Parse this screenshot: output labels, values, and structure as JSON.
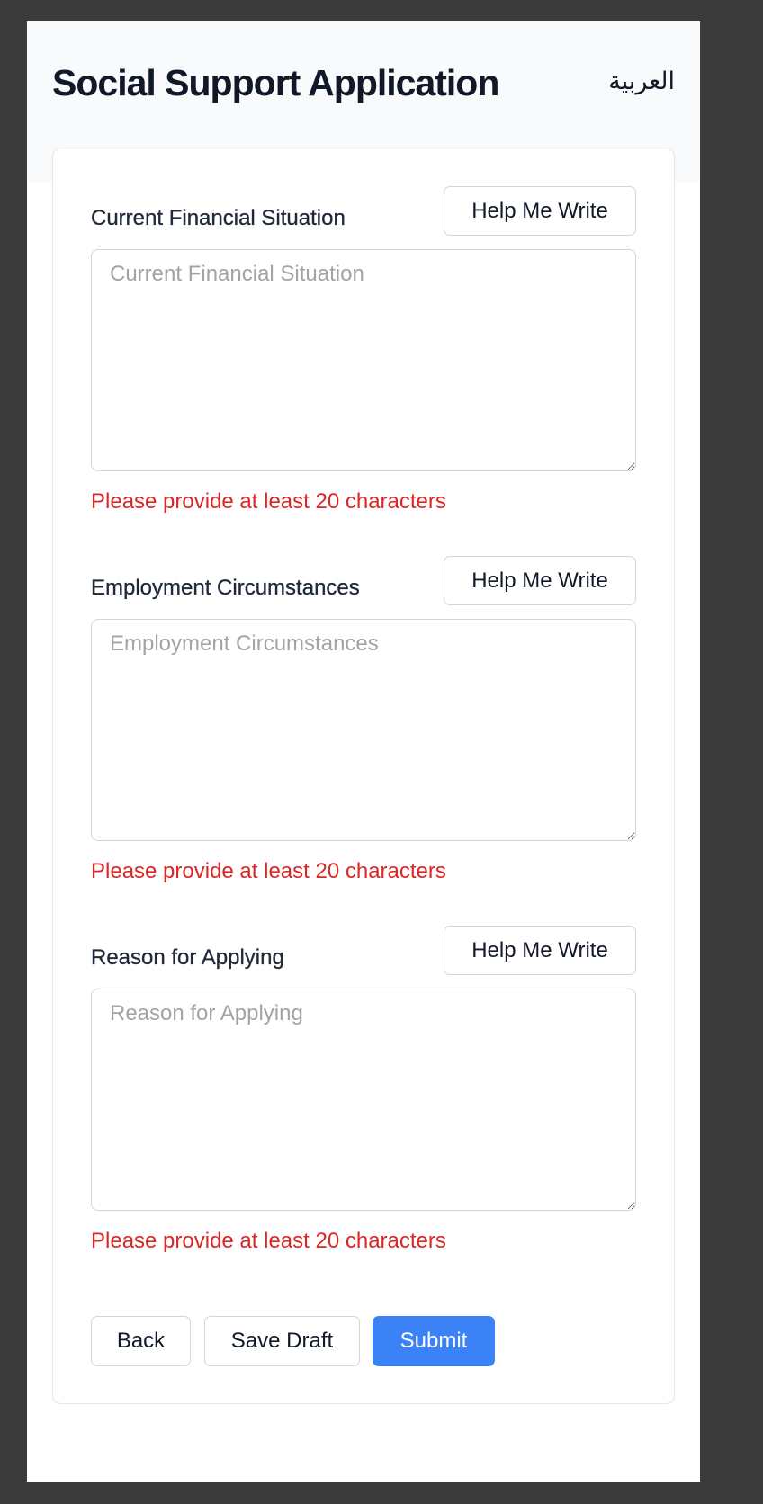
{
  "header": {
    "title": "Social Support Application",
    "language_toggle": "العربية"
  },
  "fields": [
    {
      "label": "Current Financial Situation",
      "help_button": "Help Me Write",
      "placeholder": "Current Financial Situation",
      "value": "",
      "error": "Please provide at least 20 characters"
    },
    {
      "label": "Employment Circumstances",
      "help_button": "Help Me Write",
      "placeholder": "Employment Circumstances",
      "value": "",
      "error": "Please provide at least 20 characters"
    },
    {
      "label": "Reason for Applying",
      "help_button": "Help Me Write",
      "placeholder": "Reason for Applying",
      "value": "",
      "error": "Please provide at least 20 characters"
    }
  ],
  "actions": {
    "back": "Back",
    "save_draft": "Save Draft",
    "submit": "Submit"
  },
  "colors": {
    "primary": "#3b82f6",
    "error": "#dc2626",
    "backdrop": "#3b3b3b"
  }
}
